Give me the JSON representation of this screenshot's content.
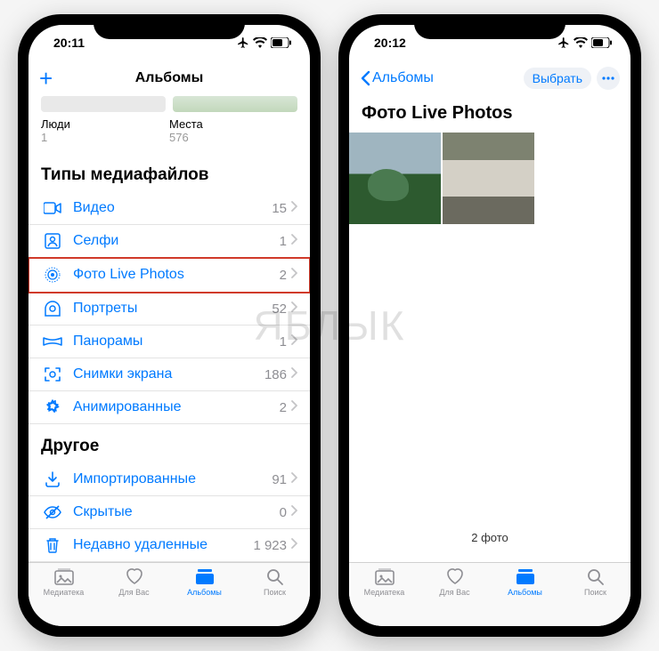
{
  "watermark": "ЯБЛЫК",
  "left": {
    "status_time": "20:11",
    "nav_title": "Альбомы",
    "people": {
      "label": "Люди",
      "count": "1"
    },
    "places": {
      "label": "Места",
      "count": "576"
    },
    "section_media": "Типы медиафайлов",
    "media_items": [
      {
        "icon": "video",
        "label": "Видео",
        "count": "15"
      },
      {
        "icon": "selfie",
        "label": "Селфи",
        "count": "1"
      },
      {
        "icon": "live",
        "label": "Фото Live Photos",
        "count": "2",
        "hl": true
      },
      {
        "icon": "portrait",
        "label": "Портреты",
        "count": "52"
      },
      {
        "icon": "pano",
        "label": "Панорамы",
        "count": "1"
      },
      {
        "icon": "screenshot",
        "label": "Снимки экрана",
        "count": "186"
      },
      {
        "icon": "gif",
        "label": "Анимированные",
        "count": "2"
      }
    ],
    "section_other": "Другое",
    "other_items": [
      {
        "icon": "import",
        "label": "Импортированные",
        "count": "91"
      },
      {
        "icon": "hidden",
        "label": "Скрытые",
        "count": "0"
      },
      {
        "icon": "trash",
        "label": "Недавно удаленные",
        "count": "1 923"
      }
    ]
  },
  "right": {
    "status_time": "20:12",
    "back_label": "Альбомы",
    "select_label": "Выбрать",
    "title": "Фото Live Photos",
    "footer": "2 фото"
  },
  "tabs": {
    "library": "Медиатека",
    "foryou": "Для Вас",
    "albums": "Альбомы",
    "search": "Поиск"
  }
}
